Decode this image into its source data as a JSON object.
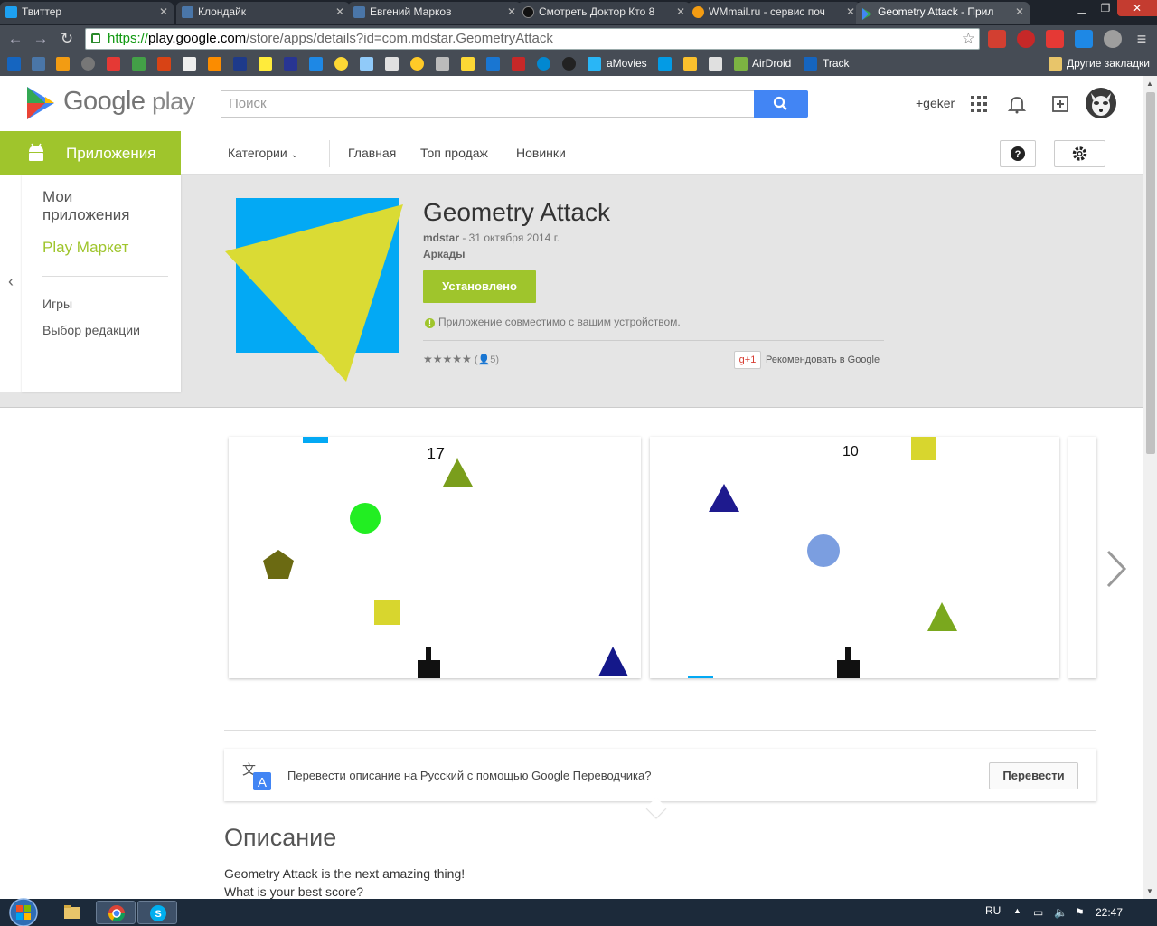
{
  "browser": {
    "tabs": [
      {
        "title": "Твиттер",
        "color": "#1da1f2"
      },
      {
        "title": "Клондайк",
        "color": "#4a76a8"
      },
      {
        "title": "Евгений Марков",
        "color": "#4a76a8"
      },
      {
        "title": "Смотреть Доктор Кто 8",
        "color": "#222222"
      },
      {
        "title": "WMmail.ru - сервис поч",
        "color": "#f39c12"
      },
      {
        "title": "Geometry Attack - Прил",
        "color": "#34a853"
      }
    ],
    "url": {
      "scheme": "https://",
      "host": "play.google.com",
      "path": "/store/apps/details?id=com.mdstar.GeometryAttack"
    },
    "bookmarks": {
      "labels": [
        "aMovies",
        "AirDroid",
        "Track"
      ],
      "other": "Другие закладки"
    }
  },
  "header": {
    "logo_google": "Google",
    "logo_play": "play",
    "search_placeholder": "Поиск",
    "user": "+geker"
  },
  "subnav": {
    "section": "Приложения",
    "categories": "Категории",
    "links": [
      "Главная",
      "Топ продаж",
      "Новинки"
    ]
  },
  "sidebar": {
    "my_apps": "Мои приложения",
    "play_market": "Play Маркет",
    "items": [
      "Игры",
      "Выбор редакции"
    ]
  },
  "app": {
    "title": "Geometry Attack",
    "developer": "mdstar",
    "date": " - 31 октября 2014 г.",
    "genre": "Аркады",
    "install_label": "Установлено",
    "compat_text": "Приложение совместимо с вашим устройством.",
    "rating_count": "5",
    "plus_one": "+1",
    "recommend": "Рекомендовать в Google",
    "colors": {
      "accent": "#9fc52c",
      "icon_bg": "#03a9f4",
      "icon_triangle": "#dadb34"
    }
  },
  "screenshots": {
    "shot1_score": "17",
    "shot2_score": "10"
  },
  "translate": {
    "text": "Перевести описание на Русский с помощью Google Переводчика?",
    "button": "Перевести"
  },
  "description": {
    "title": "Описание",
    "lines": [
      "Geometry Attack is the next amazing thing!",
      "What is your best score?"
    ]
  },
  "taskbar": {
    "lang": "RU",
    "time": "22:47"
  }
}
